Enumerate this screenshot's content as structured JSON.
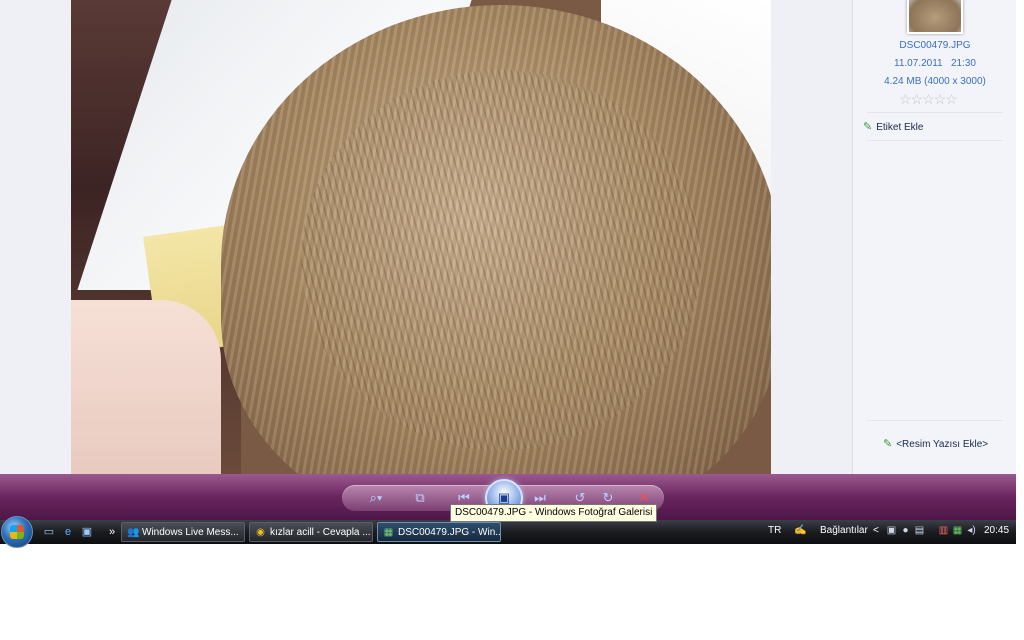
{
  "window_title": "Windows Fotoğraf Galerisi",
  "info_pane": {
    "file_name": "DSC00479.JPG",
    "date": "11.07.2011",
    "time": "21:30",
    "size_line": "4.24 MB (4000 x 3000)",
    "rating": "☆☆☆☆☆",
    "add_tag": "Etiket Ekle",
    "add_caption": "<Resim Yazısı Ekle>"
  },
  "tooltip": "DSC00479.JPG - Windows Fotoğraf Galerisi",
  "controls": {
    "zoom": "⌕▾",
    "fit": "⧉",
    "prev": "⏮",
    "slideshow": "▣",
    "next": "⏭",
    "rotate_left": "↺",
    "rotate_right": "↻",
    "delete": "✕"
  },
  "taskbar": {
    "more": "»",
    "items": [
      {
        "label": "Windows Live Mess...",
        "icon": "👥"
      },
      {
        "label": "kızlar acill - Cevapla ...",
        "icon": "◉"
      },
      {
        "label": "DSC00479.JPG - Win...",
        "icon": "▦"
      }
    ],
    "language": "TR",
    "links": "Bağlantılar",
    "links_arrow": "<",
    "clock": "20:45"
  }
}
